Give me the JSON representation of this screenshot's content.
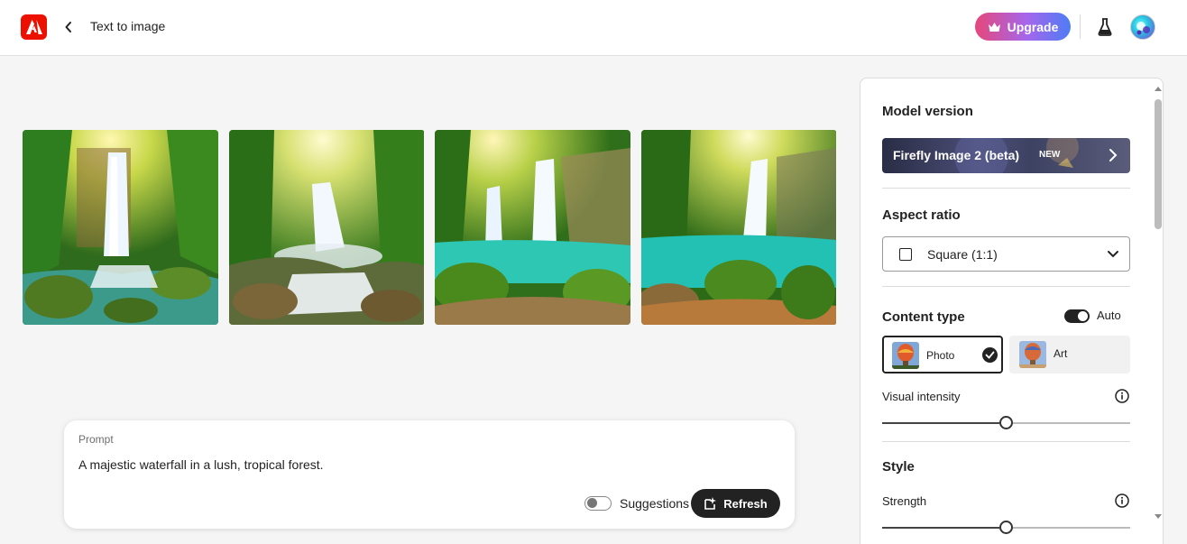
{
  "header": {
    "page_title": "Text to image",
    "upgrade_label": "Upgrade",
    "brand_color": "#eb1000"
  },
  "images": [
    {
      "alt": "waterfall-image-1"
    },
    {
      "alt": "waterfall-image-2"
    },
    {
      "alt": "waterfall-image-3"
    },
    {
      "alt": "waterfall-image-4"
    }
  ],
  "prompt": {
    "label": "Prompt",
    "text": "A majestic waterfall in a lush, tropical forest.",
    "suggestions_label": "Suggestions",
    "suggestions_on": false,
    "refresh_label": "Refresh"
  },
  "panel": {
    "model_heading": "Model version",
    "model_name": "Firefly Image 2 (beta)",
    "model_badge": "NEW",
    "aspect_heading": "Aspect ratio",
    "aspect_value": "Square (1:1)",
    "content_heading": "Content type",
    "auto_label": "Auto",
    "auto_on": true,
    "content_options": [
      {
        "label": "Photo",
        "selected": true
      },
      {
        "label": "Art",
        "selected": false
      }
    ],
    "visual_intensity_label": "Visual intensity",
    "visual_intensity_value": 0.5,
    "style_heading": "Style",
    "strength_label": "Strength",
    "strength_value": 0.5
  }
}
